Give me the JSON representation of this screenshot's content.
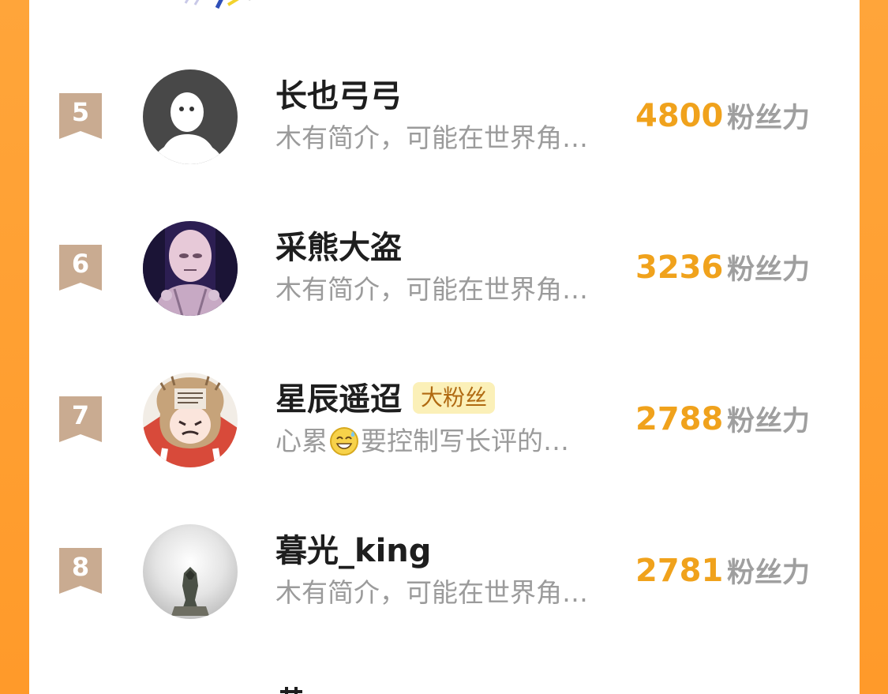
{
  "rankings": [
    {
      "rank": "5",
      "name": "长也弓弓",
      "badge": "",
      "bio": "木有简介，可能在世界角…",
      "score": "4800",
      "unit": "粉丝力",
      "avatar": "default-avatar"
    },
    {
      "rank": "6",
      "name": "采熊大盗",
      "badge": "",
      "bio": "木有简介，可能在世界角…",
      "score": "3236",
      "unit": "粉丝力",
      "avatar": "anime-bald-hero-avatar"
    },
    {
      "rank": "7",
      "name": "星辰遥迢",
      "badge": "大粉丝",
      "bio_before": "心累",
      "bio_after": "要控制写长评的…",
      "score": "2788",
      "unit": "粉丝力",
      "avatar": "manga-girl-avatar"
    },
    {
      "rank": "8",
      "name": "暮光_king",
      "badge": "",
      "bio": "木有简介，可能在世界角…",
      "score": "2781",
      "unit": "粉丝力",
      "avatar": "hooded-figure-avatar"
    }
  ],
  "colors": {
    "background_orange": "#ff9a2a",
    "score": "#f0a21c",
    "rank_ribbon": "#c9ab91",
    "badge_bg": "#fbf0b8",
    "badge_text": "#b06a12"
  }
}
